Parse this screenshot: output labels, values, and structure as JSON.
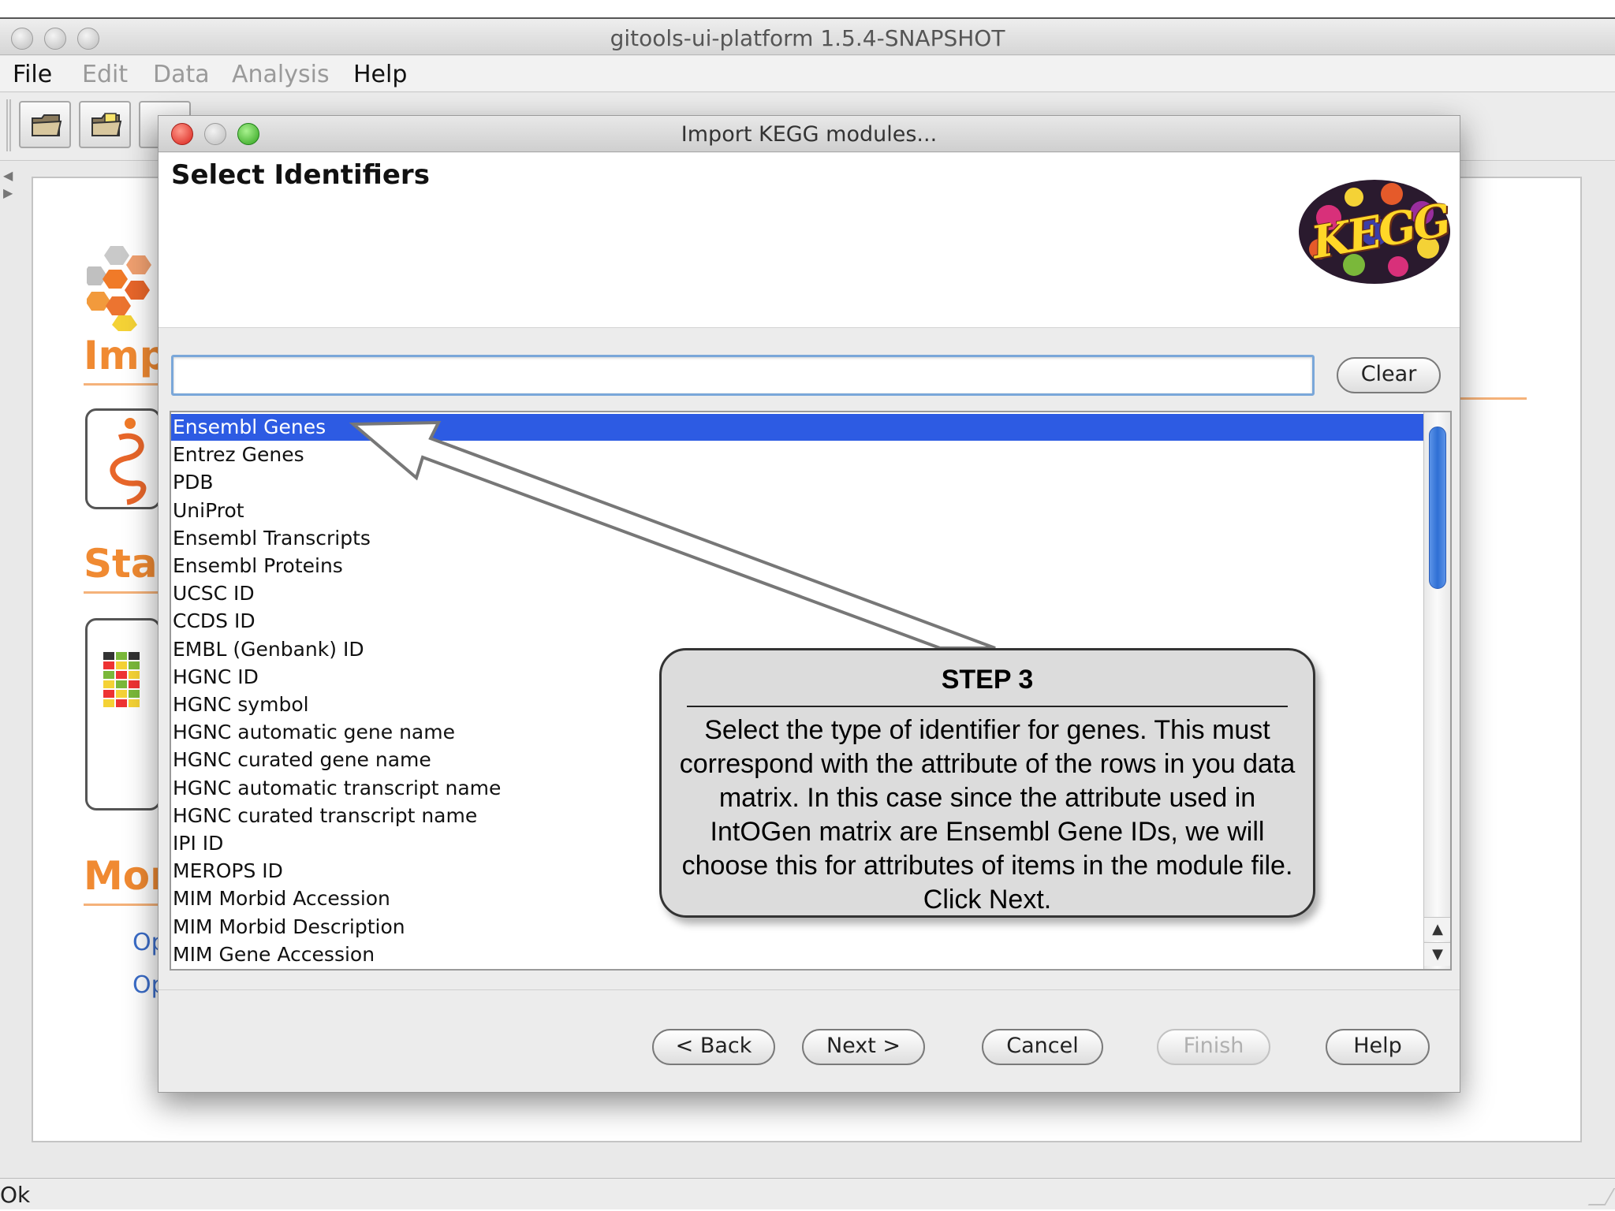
{
  "app": {
    "window_title": "gitools-ui-platform 1.5.4-SNAPSHOT",
    "menu": [
      "File",
      "Edit",
      "Data",
      "Analysis",
      "Help"
    ],
    "background_headings": [
      "Imp",
      "Star",
      "Mor"
    ],
    "background_links": [
      "Op",
      "Op"
    ],
    "status_text": "Ok"
  },
  "dialog": {
    "title": "Import KEGG modules...",
    "heading": "Select Identifiers",
    "logo_text": "KEGG",
    "search": {
      "value": "",
      "placeholder": ""
    },
    "clear_label": "Clear",
    "identifiers": [
      "Ensembl Genes",
      "Entrez Genes",
      "PDB",
      "UniProt",
      "Ensembl Transcripts",
      "Ensembl Proteins",
      "UCSC ID",
      "CCDS ID",
      "EMBL (Genbank) ID",
      "HGNC ID",
      "HGNC symbol",
      "HGNC automatic gene name",
      "HGNC curated gene name",
      "HGNC automatic transcript name",
      "HGNC curated transcript name",
      "IPI ID",
      "MEROPS ID",
      "MIM Morbid Accession",
      "MIM Morbid Description",
      "MIM Gene Accession"
    ],
    "selected_index": 0,
    "buttons": {
      "back": "< Back",
      "next": "Next >",
      "cancel": "Cancel",
      "finish": "Finish",
      "help": "Help"
    }
  },
  "annotation": {
    "title": "STEP 3",
    "body": "Select the type of identifier for genes. This must correspond with the attribute of the rows in you data matrix. In this case since the attribute used in IntOGen matrix are Ensembl Gene IDs, we will choose this for attributes of items in the module file. Click Next."
  },
  "colors": {
    "selection": "#2d5be3",
    "accent_orange": "#f08a32",
    "close_red": "#d8211a",
    "zoom_green": "#2ea21b"
  }
}
